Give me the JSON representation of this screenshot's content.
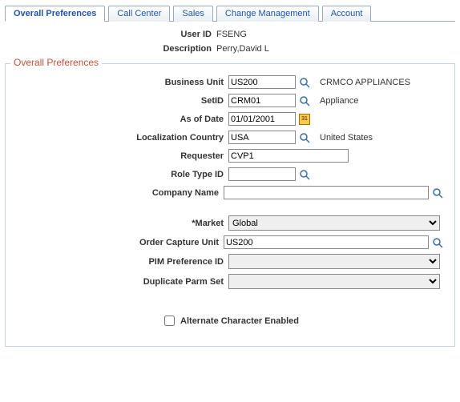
{
  "tabs": {
    "overall": "Overall Preferences",
    "call": "Call Center",
    "sales": "Sales",
    "change": "Change Management",
    "account": "Account"
  },
  "header": {
    "user_id_label": "User ID",
    "user_id": "FSENG",
    "desc_label": "Description",
    "desc": "Perry,David L"
  },
  "group": {
    "title": "Overall Preferences",
    "bu_label": "Business Unit",
    "bu_value": "US200",
    "bu_desc": "CRMCO APPLIANCES",
    "setid_label": "SetID",
    "setid_value": "CRM01",
    "setid_desc": "Appliance",
    "asof_label": "As of Date",
    "asof_value": "01/01/2001",
    "loc_label": "Localization Country",
    "loc_value": "USA",
    "loc_desc": "United States",
    "req_label": "Requester",
    "req_value": "CVP1",
    "role_label": "Role Type ID",
    "role_value": "",
    "company_label": "Company Name",
    "company_value": "",
    "market_label": "*Market",
    "market_value": "Global",
    "ocu_label": "Order Capture Unit",
    "ocu_value": "US200",
    "pim_label": "PIM Preference ID",
    "pim_value": "",
    "dup_label": "Duplicate Parm Set",
    "dup_value": "",
    "alt_label": "Alternate Character Enabled"
  }
}
